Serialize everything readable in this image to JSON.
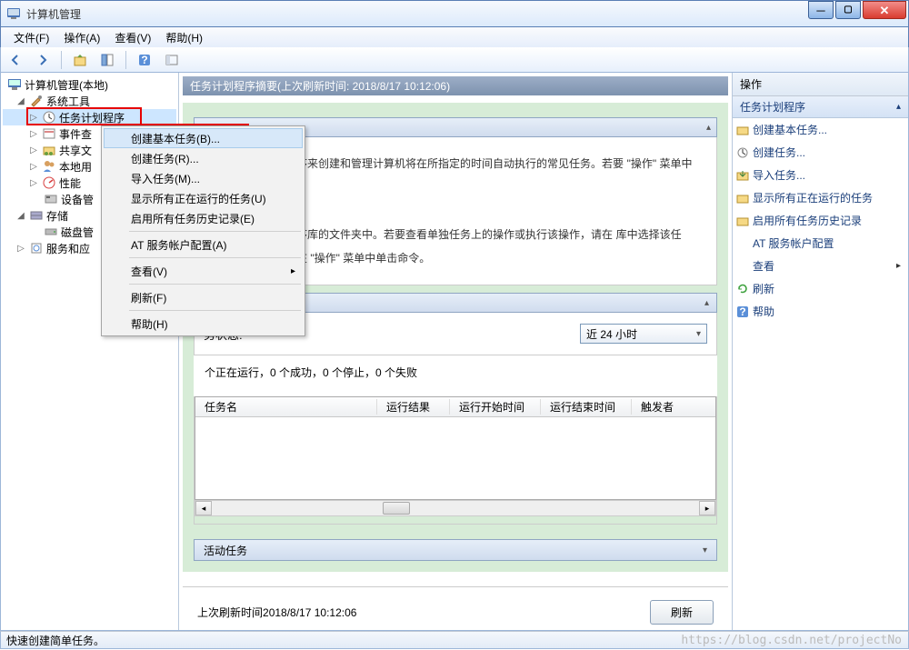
{
  "window": {
    "title": "计算机管理"
  },
  "menubar": {
    "file": "文件(F)",
    "action": "操作(A)",
    "view": "查看(V)",
    "help": "帮助(H)"
  },
  "tree": {
    "root": "计算机管理(本地)",
    "system_tools": "系统工具",
    "task_scheduler": "任务计划程序",
    "event_viewer": "事件查",
    "shared": "共享文",
    "local": "本地用",
    "perf": "性能",
    "devmgr": "设备管",
    "storage": "存储",
    "diskmgr": "磁盘管",
    "services": "服务和应"
  },
  "context_menu": {
    "create_basic": "创建基本任务(B)...",
    "create_task": "创建任务(R)...",
    "import_task": "导入任务(M)...",
    "show_running": "显示所有正在运行的任务(U)",
    "enable_history": "启用所有任务历史记录(E)",
    "at_config": "AT 服务帐户配置(A)",
    "view": "查看(V)",
    "refresh": "刷新(F)",
    "help": "帮助(H)"
  },
  "center": {
    "header": "任务计划程序摘要(上次刷新时间: 2018/8/17 10:12:06)",
    "overview_p1": "务计划程序来创建和管理计算机将在所指定的时间自动执行的常见任务。若要",
    "overview_p1b": "\"操作\"  菜单中的命令。",
    "overview_p2": "务计划程序库的文件夹中。若要查看单独任务上的操作或执行该操作，请在",
    "overview_p2b": "库中选择该任务，然后在 \"操作\"  菜单中单击命令。",
    "status_label": "任务状态",
    "status_label2": "务状态:",
    "time_combo": "近 24 小时",
    "status_summary": "个正在运行，0 个成功，0 个停止，0 个失败",
    "table": {
      "col1": "任务名",
      "col2": "运行结果",
      "col3": "运行开始时间",
      "col4": "运行结束时间",
      "col5": "触发者"
    },
    "active_tasks": "活动任务",
    "last_refresh_label": "上次刷新时间",
    "last_refresh_time": "2018/8/17 10:12:06",
    "refresh_btn": "刷新"
  },
  "actions": {
    "title": "操作",
    "section": "任务计划程序",
    "create_basic": "创建基本任务...",
    "create_task": "创建任务...",
    "import_task": "导入任务...",
    "show_running": "显示所有正在运行的任务",
    "enable_history": "启用所有任务历史记录",
    "at_config": "AT 服务帐户配置",
    "view": "查看",
    "refresh": "刷新",
    "help": "帮助"
  },
  "statusbar": {
    "text": "快速创建简单任务。"
  },
  "watermark": "https://blog.csdn.net/projectNo"
}
